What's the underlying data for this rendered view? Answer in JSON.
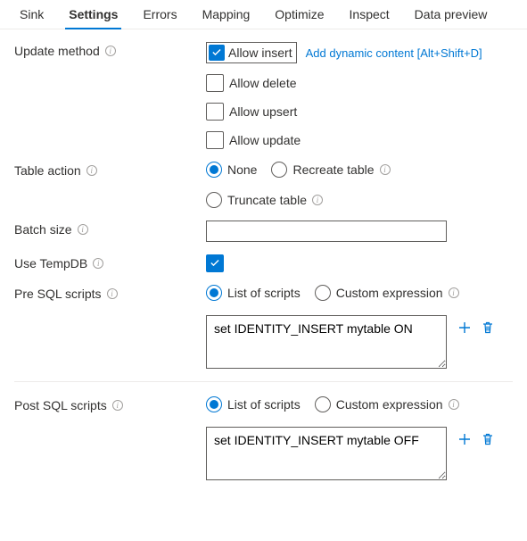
{
  "tabs": {
    "items": [
      "Sink",
      "Settings",
      "Errors",
      "Mapping",
      "Optimize",
      "Inspect",
      "Data preview"
    ],
    "active": "Settings"
  },
  "updateMethod": {
    "label": "Update method",
    "options": {
      "allowInsert": {
        "label": "Allow insert",
        "checked": true
      },
      "allowDelete": {
        "label": "Allow delete",
        "checked": false
      },
      "allowUpsert": {
        "label": "Allow upsert",
        "checked": false
      },
      "allowUpdate": {
        "label": "Allow update",
        "checked": false
      }
    },
    "dynamicLink": "Add dynamic content [Alt+Shift+D]"
  },
  "tableAction": {
    "label": "Table action",
    "options": {
      "none": "None",
      "recreate": "Recreate table",
      "truncate": "Truncate table"
    },
    "selected": "none"
  },
  "batchSize": {
    "label": "Batch size",
    "value": ""
  },
  "useTempDb": {
    "label": "Use TempDB",
    "checked": true
  },
  "preSql": {
    "label": "Pre SQL scripts",
    "mode": {
      "list": "List of scripts",
      "custom": "Custom expression",
      "selected": "list"
    },
    "script": "set IDENTITY_INSERT mytable ON"
  },
  "postSql": {
    "label": "Post SQL scripts",
    "mode": {
      "list": "List of scripts",
      "custom": "Custom expression",
      "selected": "list"
    },
    "script": "set IDENTITY_INSERT mytable OFF"
  }
}
